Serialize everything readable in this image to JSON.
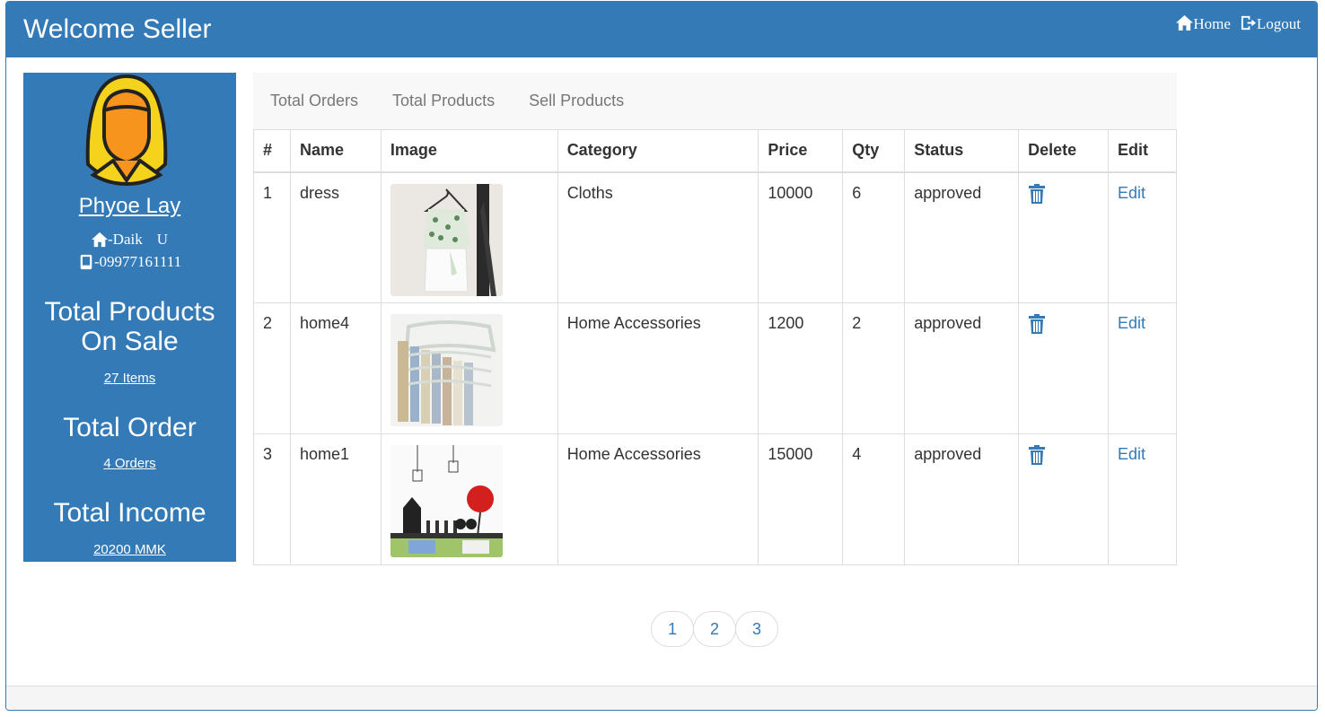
{
  "header": {
    "title": "Welcome Seller",
    "home_label": "Home",
    "logout_label": "Logout"
  },
  "sidebar": {
    "name": "Phyoe Lay",
    "address": "-Daik",
    "address_suffix": "U",
    "phone": "-09977161111",
    "stats": [
      {
        "title": "Total Products On Sale",
        "value": "27 Items"
      },
      {
        "title": "Total Order",
        "value": "4 Orders"
      },
      {
        "title": "Total Income",
        "value": "20200 MMK"
      }
    ]
  },
  "tabs": [
    "Total Orders",
    "Total Products",
    "Sell Products"
  ],
  "table": {
    "headers": [
      "#",
      "Name",
      "Image",
      "Category",
      "Price",
      "Qty",
      "Status",
      "Delete",
      "Edit"
    ],
    "rows": [
      {
        "num": "1",
        "name": "dress",
        "category": "Cloths",
        "price": "10000",
        "qty": "6",
        "status": "approved",
        "edit": "Edit"
      },
      {
        "num": "2",
        "name": "home4",
        "category": "Home Accessories",
        "price": "1200",
        "qty": "2",
        "status": "approved",
        "edit": "Edit"
      },
      {
        "num": "3",
        "name": "home1",
        "category": "Home Accessories",
        "price": "15000",
        "qty": "4",
        "status": "approved",
        "edit": "Edit"
      }
    ]
  },
  "pagination": [
    "1",
    "2",
    "3"
  ],
  "colors": {
    "primary": "#337ab7",
    "tab_bg": "#f8f8f8",
    "avatar_yellow": "#f5d21b",
    "avatar_orange": "#f7941d"
  }
}
